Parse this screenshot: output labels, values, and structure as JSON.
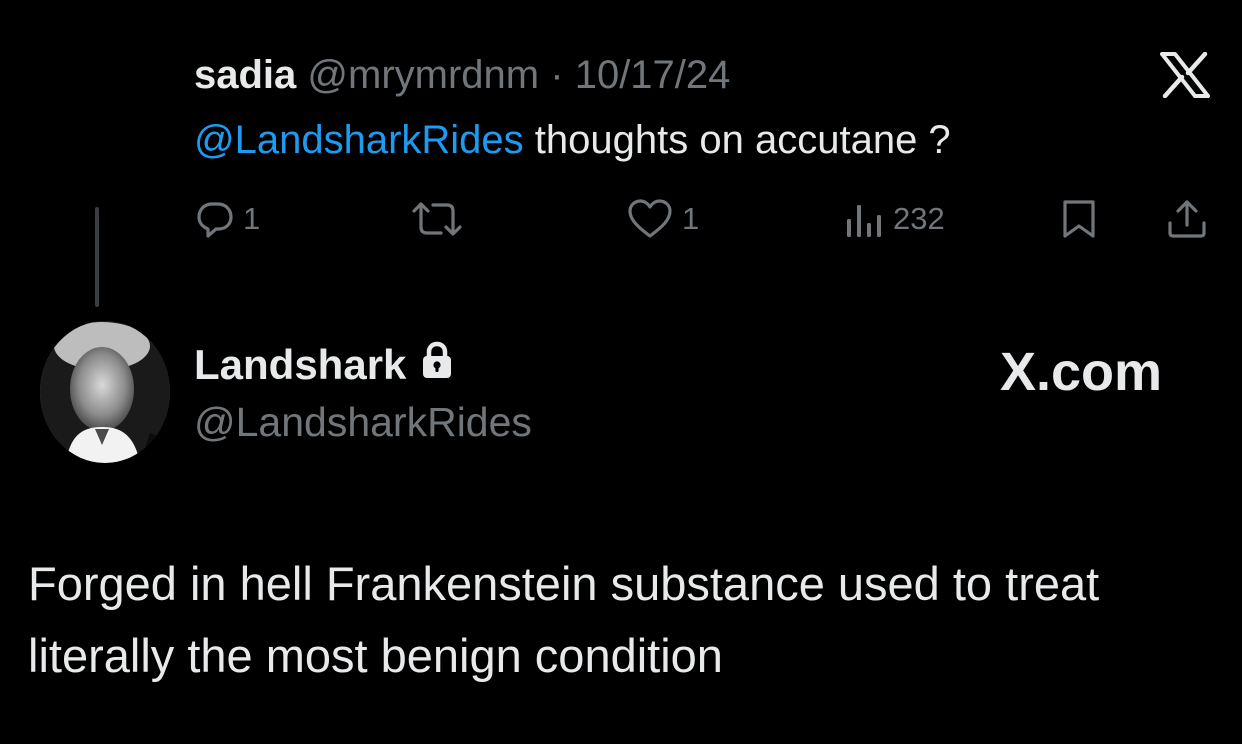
{
  "parent_tweet": {
    "author_name": "sadia",
    "author_handle": "@mrymrdnm",
    "separator": "·",
    "date": "10/17/24",
    "mention": "@LandsharkRides",
    "text": "thoughts on accutane ?",
    "actions": {
      "replies": "1",
      "likes": "1",
      "views": "232"
    },
    "icons": [
      "reply-icon",
      "retweet-icon",
      "like-icon",
      "views-icon",
      "bookmark-icon",
      "share-icon"
    ]
  },
  "brand": {
    "logo_icon": "x-logo-icon",
    "site": "X.com"
  },
  "reply_tweet": {
    "author_name": "Landshark",
    "author_handle": "@LandsharkRides",
    "text": "Forged in hell Frankenstein substance used to treat literally the most benign condition",
    "icons": [
      "lock-icon"
    ]
  },
  "colors": {
    "background": "#000000",
    "text": "#e7e9ea",
    "muted": "#71767b",
    "link": "#1d9bf0"
  }
}
